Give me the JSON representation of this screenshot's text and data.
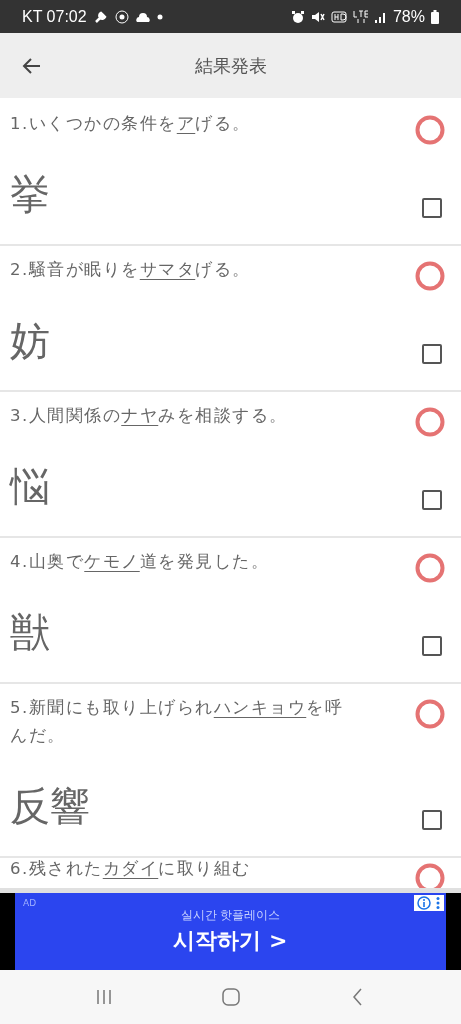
{
  "status_bar": {
    "carrier_time": "KT 07:02",
    "battery": "78%"
  },
  "header": {
    "title": "結果発表"
  },
  "questions": [
    {
      "number": "1.",
      "before": "いくつかの条件を",
      "underlined": "ア",
      "after": "げる。",
      "answer": "挙",
      "correct": true,
      "checked": false
    },
    {
      "number": "2.",
      "before": "騒音が眠りを",
      "underlined": "サマタ",
      "after": "げる。",
      "answer": "妨",
      "correct": true,
      "checked": false
    },
    {
      "number": "3.",
      "before": "人間関係の",
      "underlined": "ナヤ",
      "after": "みを相談する。",
      "answer": "悩",
      "correct": true,
      "checked": false
    },
    {
      "number": "4.",
      "before": "山奥で",
      "underlined": "ケモノ",
      "after": "道を発見した。",
      "answer": "獣",
      "correct": true,
      "checked": false
    },
    {
      "number": "5.",
      "before": "新聞にも取り上げられ",
      "underlined": "ハンキョウ",
      "after": "を呼んだ。",
      "answer": "反響",
      "correct": true,
      "checked": false
    },
    {
      "number": "6.",
      "before": "残された",
      "underlined": "カダイ",
      "after": "に取り組む",
      "correct": true
    }
  ],
  "ad": {
    "label": "AD",
    "subtitle": "실시간 핫플레이스",
    "headline": "시작하기 >"
  }
}
